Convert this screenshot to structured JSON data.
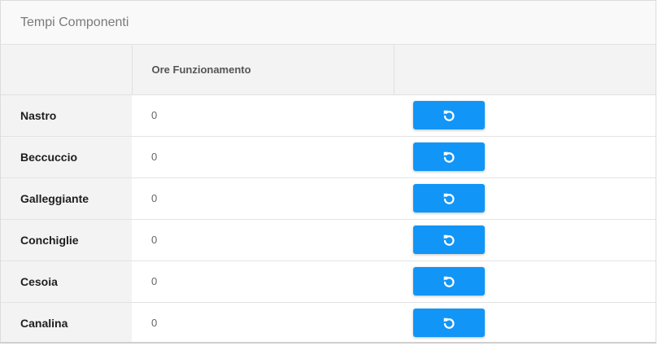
{
  "panel": {
    "title": "Tempi Componenti"
  },
  "table": {
    "headers": [
      "",
      "Ore Funzionamento",
      ""
    ],
    "rows": [
      {
        "name": "Nastro",
        "hours": "0"
      },
      {
        "name": "Beccuccio",
        "hours": "0"
      },
      {
        "name": "Galleggiante",
        "hours": "0"
      },
      {
        "name": "Conchiglie",
        "hours": "0"
      },
      {
        "name": "Cesoia",
        "hours": "0"
      },
      {
        "name": "Canalina",
        "hours": "0"
      }
    ],
    "action_icon": "reset-icon"
  },
  "colors": {
    "accent": "#1195f7",
    "header_bg": "#f9f9f9",
    "label_bg": "#f3f3f3"
  }
}
